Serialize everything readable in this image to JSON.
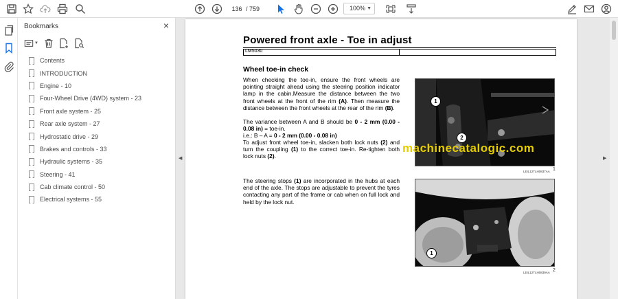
{
  "toolbar": {
    "page_current": "136",
    "page_total": "/ 759",
    "zoom": "100%"
  },
  "bookmarks": {
    "title": "Bookmarks",
    "close": "×",
    "items": [
      {
        "label": "Contents"
      },
      {
        "label": "INTRODUCTION"
      },
      {
        "label": "Engine - 10"
      },
      {
        "label": "Four-Wheel Drive (4WD) system - 23"
      },
      {
        "label": "Front axle system - 25"
      },
      {
        "label": "Rear axle system - 27"
      },
      {
        "label": "Hydrostatic drive - 29"
      },
      {
        "label": "Brakes and controls - 33"
      },
      {
        "label": "Hydraulic systems - 35"
      },
      {
        "label": "Steering - 41"
      },
      {
        "label": "Cab climate control - 50"
      },
      {
        "label": "Electrical systems - 55"
      }
    ]
  },
  "document": {
    "title": "Powered front axle - Toe in adjust",
    "code": "LM5030",
    "section_heading": "Wheel toe-in check",
    "para1": [
      {
        "t": "When checking the toe-in, ensure the front wheels are pointing straight ahead using the steering position indicator lamp in the cabin.",
        "b": false
      },
      {
        "t": "Measure the distance between the two front wheels at the front of the rim ",
        "b": false
      },
      {
        "t": "(A)",
        "b": true
      },
      {
        "t": ". Then measure the distance between the front wheels at the rear of the rim ",
        "b": false
      },
      {
        "t": "(B)",
        "b": true
      },
      {
        "t": ".",
        "b": false
      }
    ],
    "para2": [
      {
        "t": "The variance between A and B should be ",
        "b": false
      },
      {
        "t": "0 - 2 mm (0.00 - 0.08 in)",
        "b": true
      },
      {
        "t": " = toe-in.",
        "b": false
      }
    ],
    "para3": [
      {
        "t": "i.e.: B – A = ",
        "b": false
      },
      {
        "t": "0 - 2 mm (0.00 - 0.08 in)",
        "b": true
      }
    ],
    "para4": [
      {
        "t": "To adjust front wheel toe-in, slacken both lock nuts ",
        "b": false
      },
      {
        "t": "(2)",
        "b": true
      },
      {
        "t": " and turn the coupling ",
        "b": false
      },
      {
        "t": "(1)",
        "b": true
      },
      {
        "t": " to the correct toe-in. Re-tighten both lock nuts ",
        "b": false
      },
      {
        "t": "(2)",
        "b": true
      },
      {
        "t": ".",
        "b": false
      }
    ],
    "para5": [
      {
        "t": "The steering stops ",
        "b": false
      },
      {
        "t": "(1)",
        "b": true
      },
      {
        "t": " are incorporated in the hubs at each end of the axle.  The stops are adjustable to prevent the tyres contacting any part of the frame or cab when on full lock and held by the lock nut.",
        "b": false
      }
    ],
    "figure1": {
      "caption": "LEIL12TLH0837AA",
      "number": "1",
      "callouts": [
        "1",
        "2"
      ]
    },
    "figure2": {
      "caption": "LEIL12TLH0839AA",
      "number": "2",
      "callouts": [
        "1"
      ]
    },
    "watermark": "machinecatalogic.com"
  }
}
